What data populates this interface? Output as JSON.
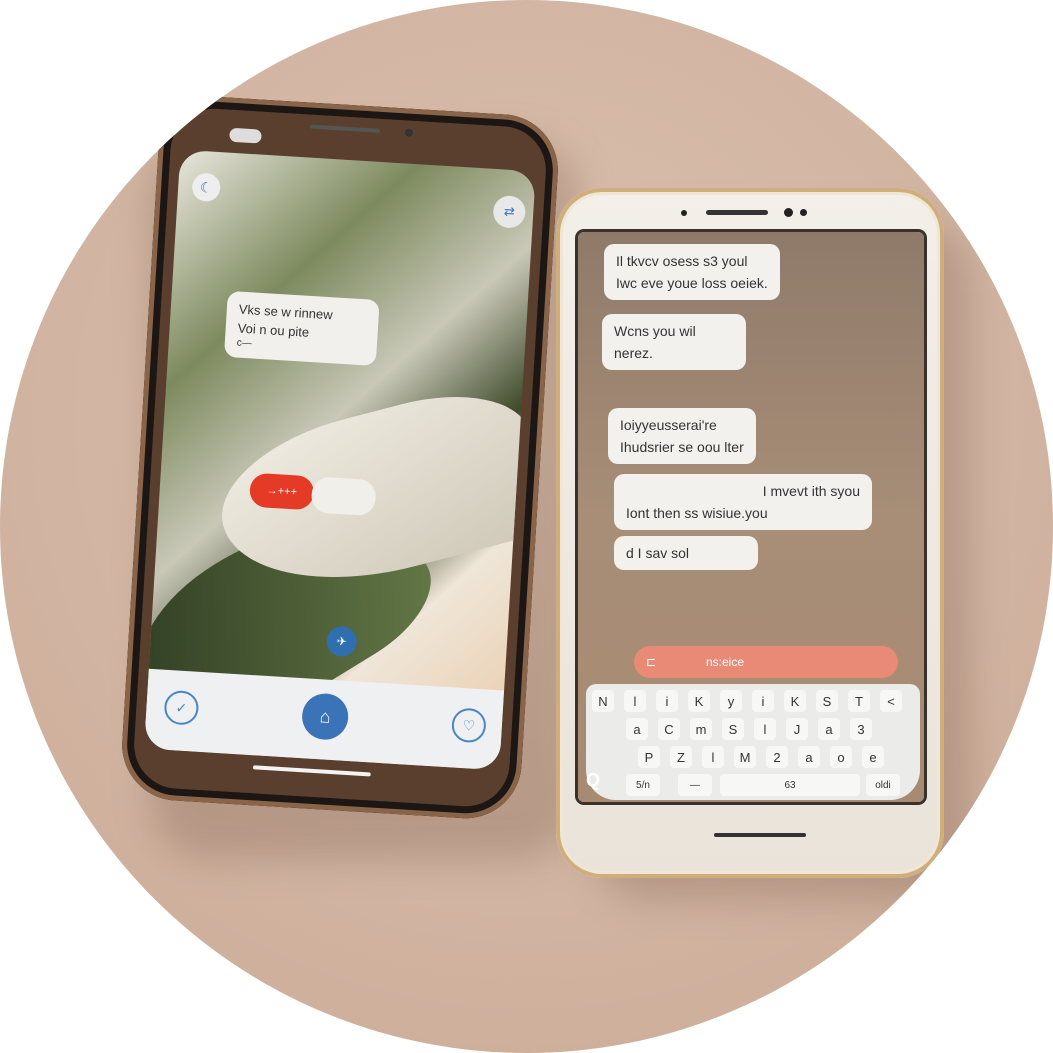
{
  "left_phone": {
    "message": [
      "Vks se w rinnew",
      "Voi n ou pite",
      "c—"
    ],
    "red_button_label": "→+++",
    "icons": [
      "moon-icon",
      "camera-switch-icon",
      "gallery-icon",
      "shutter-icon",
      "filter-icon",
      "location-icon"
    ],
    "accent": "#e53a26",
    "shutter_color": "#3b73b8"
  },
  "right_phone": {
    "messages": [
      {
        "lines": [
          "Il tkvcv osess s3 youl",
          "Iwc eve youe loss oeiek."
        ],
        "side": "left"
      },
      {
        "lines": [
          "Wcns you wil",
          "nerez."
        ],
        "side": "left"
      },
      {
        "lines": [
          "Ioiyyeusserai're",
          "Ihudsrier se oou lter"
        ],
        "side": "left"
      },
      {
        "lines": [
          "I mvevt ith syou",
          "Iont then ss wisiue.you"
        ],
        "side": "right"
      },
      {
        "lines": [
          "d I sav sol"
        ],
        "side": "left"
      }
    ],
    "input_label": "ns:eice",
    "keyboard_rows": [
      [
        "N",
        "l",
        "i",
        "K",
        "y",
        "i",
        "K",
        "S",
        "T",
        "<"
      ],
      [
        "a",
        "C",
        "m",
        "S",
        "l",
        "J",
        "a",
        "3"
      ],
      [
        "P",
        "Z",
        "l",
        "M",
        "2",
        "a",
        "o",
        "e"
      ]
    ],
    "keyboard_bottom": [
      "5/n",
      "—",
      "63",
      "oldi"
    ],
    "accent": "#e98a76"
  }
}
